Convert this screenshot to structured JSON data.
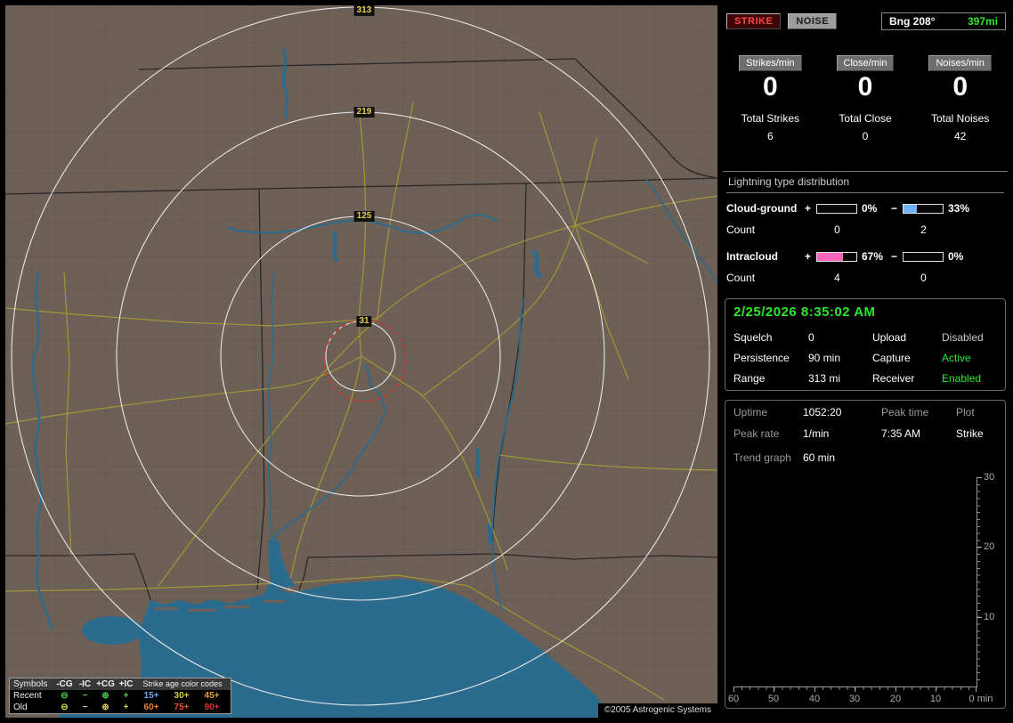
{
  "colors": {
    "green": "#2ee62e",
    "strike_red": "#ff4646",
    "bar_blue": "#6fb4f0",
    "bar_pink": "#f666b8",
    "disabled_gray": "#c8c8c8"
  },
  "map": {
    "range_labels": [
      "313",
      "219",
      "125",
      "31"
    ],
    "copyright": "©2005 Astrogenic Systems",
    "legend": {
      "symbols_header": "Symbols",
      "col_headers": [
        "-CG",
        "-IC",
        "+CG",
        "+IC"
      ],
      "age_header": "Strike age color codes",
      "symbols": [
        "⊖",
        "−",
        "⊕",
        "+"
      ],
      "recent_label": "Recent",
      "old_label": "Old",
      "recent_symbol_color": "#3fd23f",
      "old_symbol_color": "#d8d23f",
      "recent_ages": [
        "15+",
        "30+",
        "45+"
      ],
      "old_ages": [
        "60+",
        "75+",
        "90+"
      ],
      "recent_age_colors": [
        "#6fa8e8",
        "#d8d23f",
        "#e8a03c"
      ],
      "old_age_colors": [
        "#e8802c",
        "#e8502c",
        "#e03030"
      ]
    }
  },
  "sidebar": {
    "mode": {
      "strike": "STRIKE",
      "noise": "NOISE"
    },
    "bearing": {
      "label": "Bng 208°",
      "distance": "397mi"
    },
    "counters": {
      "strikes": {
        "chip": "Strikes/min",
        "value": "0",
        "total_label": "Total Strikes",
        "total_value": "6"
      },
      "close": {
        "chip": "Close/min",
        "value": "0",
        "total_label": "Total Close",
        "total_value": "0"
      },
      "noises": {
        "chip": "Noises/min",
        "value": "0",
        "total_label": "Total Noises",
        "total_value": "42"
      }
    },
    "distribution": {
      "title": "Lightning type distribution",
      "cloud_ground": {
        "label": "Cloud-ground",
        "plus_sign": "+",
        "minus_sign": "−",
        "plus_pct": "0%",
        "minus_pct": "33%",
        "plus_fill": 0,
        "minus_fill": 33,
        "count_label": "Count",
        "plus_count": "0",
        "minus_count": "2"
      },
      "intracloud": {
        "label": "Intracloud",
        "plus_sign": "+",
        "minus_sign": "−",
        "plus_pct": "67%",
        "minus_pct": "0%",
        "plus_fill": 67,
        "minus_fill": 0,
        "count_label": "Count",
        "plus_count": "4",
        "minus_count": "0"
      }
    },
    "clock": {
      "datetime": "2/25/2026 8:35:02 AM"
    },
    "settings": {
      "squelch_label": "Squelch",
      "squelch": "0",
      "persistence_label": "Persistence",
      "persistence": "90 min",
      "range_label": "Range",
      "range": "313 mi",
      "upload_label": "Upload",
      "upload": "Disabled",
      "capture_label": "Capture",
      "capture": "Active",
      "receiver_label": "Receiver",
      "receiver": "Enabled"
    },
    "stats": {
      "uptime_label": "Uptime",
      "uptime": "1052:20",
      "peak_time_label": "Peak time",
      "peak_time": "7:35 AM",
      "plot_label": "Plot",
      "plot": "Strike",
      "peak_rate_label": "Peak rate",
      "peak_rate": "1/min",
      "trend_label": "Trend graph",
      "trend_period": "60 min"
    },
    "trend": {
      "y_ticks": [
        "30",
        "20",
        "10"
      ],
      "x_ticks": [
        "60",
        "50",
        "40",
        "30",
        "20",
        "10"
      ],
      "x_end_label": "0 min"
    }
  }
}
